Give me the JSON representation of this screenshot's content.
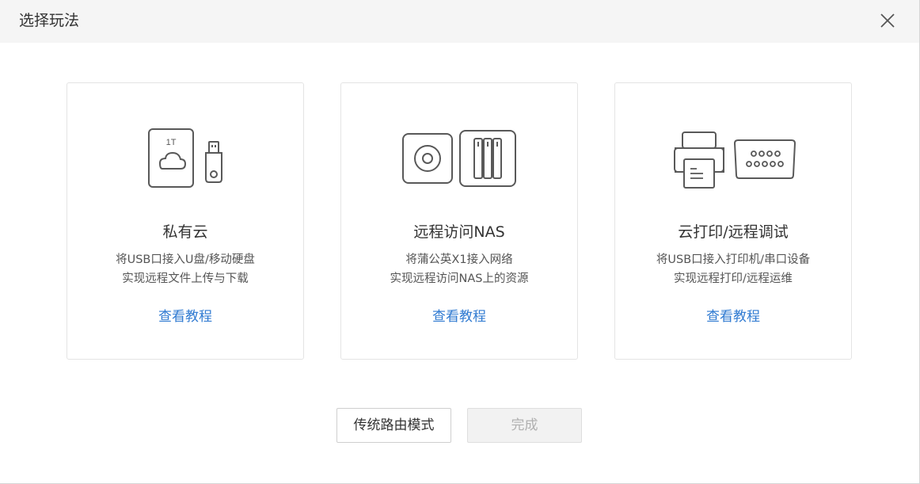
{
  "dialog": {
    "title": "选择玩法",
    "close_icon": "close-icon"
  },
  "cards": [
    {
      "title": "私有云",
      "desc_line1": "将USB口接入U盘/移动硬盘",
      "desc_line2": "实现远程文件上传与下载",
      "link": "查看教程",
      "icons": [
        "hard-drive-cloud-icon",
        "usb-flash-drive-icon"
      ],
      "drive_label": "1T"
    },
    {
      "title": "远程访问NAS",
      "desc_line1": "将蒲公英X1接入网络",
      "desc_line2": "实现远程访问NAS上的资源",
      "link": "查看教程",
      "icons": [
        "device-icon",
        "nas-icon"
      ]
    },
    {
      "title": "云打印/远程调试",
      "desc_line1": "将USB口接入打印机/串口设备",
      "desc_line2": "实现远程打印/远程运维",
      "link": "查看教程",
      "icons": [
        "printer-icon",
        "serial-port-icon"
      ]
    }
  ],
  "footer": {
    "legacy_button": "传统路由模式",
    "done_button": "完成"
  },
  "colors": {
    "link": "#2f7ad1",
    "titlebar_bg": "#f5f5f5",
    "disabled_button_bg": "#f2f2f2"
  }
}
